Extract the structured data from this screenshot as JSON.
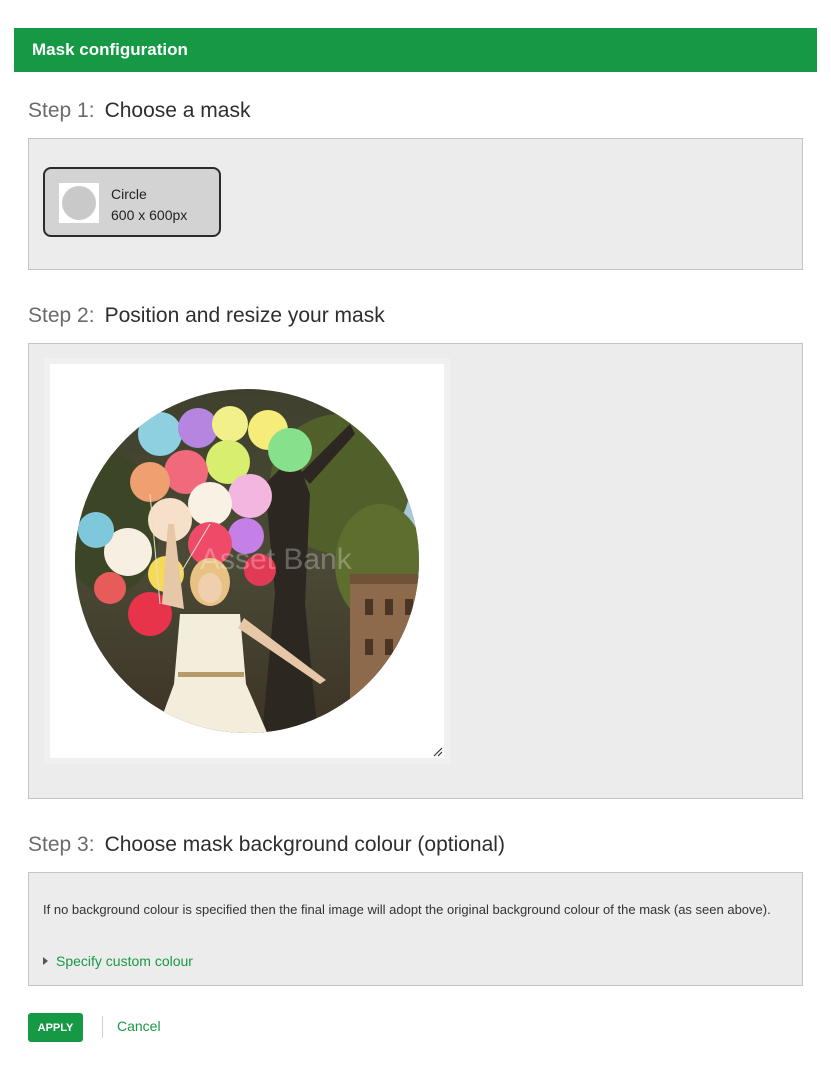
{
  "header": {
    "title": "Mask configuration"
  },
  "step1": {
    "number": "Step 1:",
    "title": "Choose a mask",
    "mask": {
      "name": "Circle",
      "size": "600 x 600px",
      "icon": "circle-mask-thumbnail"
    }
  },
  "step2": {
    "number": "Step 2:",
    "title": "Position and resize your mask",
    "preview": {
      "watermark": "Asset Bank",
      "image_subject": "woman holding colourful balloons under a tree"
    }
  },
  "step3": {
    "number": "Step 3:",
    "title": "Choose mask background colour (optional)",
    "info": "If no background colour is specified then the final image will adopt the original background colour of the mask (as seen above).",
    "toggle_label": "Specify custom colour"
  },
  "actions": {
    "apply_label": "APPLY",
    "cancel_label": "Cancel"
  },
  "colors": {
    "brand": "#169945",
    "panel_bg": "#ececec",
    "panel_border": "#c4c4c4"
  }
}
